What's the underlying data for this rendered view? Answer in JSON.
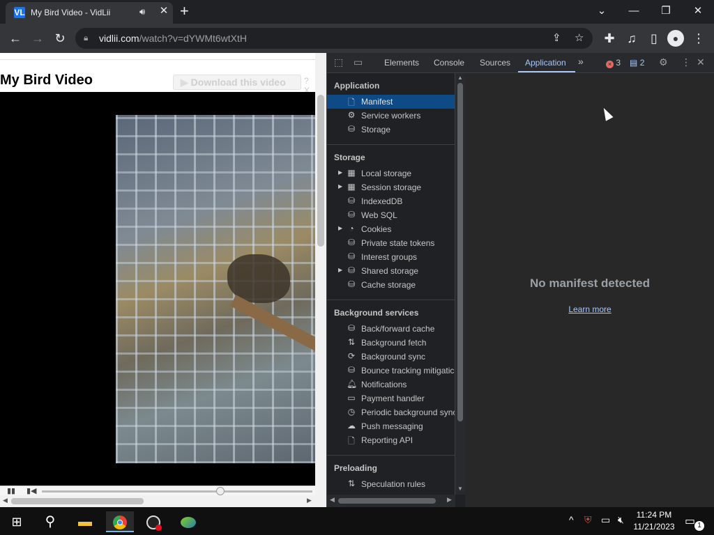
{
  "browser": {
    "tab": {
      "favicon": "VL",
      "title": "My Bird Video - VidLii",
      "audio_icon": "speaker-icon",
      "close": "✕"
    },
    "new_tab": "+",
    "window_controls": {
      "minimize": "—",
      "restore": "❐",
      "close": "✕",
      "tab_search": "⌄"
    },
    "url_host": "vidlii.com",
    "url_path": "/watch?v=dYWMt6wtXtH"
  },
  "page": {
    "title": "My Bird Video",
    "download_button": "Download this video",
    "help": "?",
    "close": "X"
  },
  "devtools": {
    "tabs": [
      "Elements",
      "Console",
      "Sources",
      "Application"
    ],
    "active_tab": "Application",
    "more_tabs": "»",
    "errors": "3",
    "messages": "2",
    "sections": {
      "application": {
        "header": "Application",
        "items": [
          {
            "label": "Manifest",
            "icon": "document-icon",
            "selected": true
          },
          {
            "label": "Service workers",
            "icon": "gears-icon"
          },
          {
            "label": "Storage",
            "icon": "database-icon"
          }
        ]
      },
      "storage": {
        "header": "Storage",
        "items": [
          {
            "label": "Local storage",
            "icon": "table-icon",
            "expandable": true
          },
          {
            "label": "Session storage",
            "icon": "table-icon",
            "expandable": true
          },
          {
            "label": "IndexedDB",
            "icon": "database-icon"
          },
          {
            "label": "Web SQL",
            "icon": "database-icon"
          },
          {
            "label": "Cookies",
            "icon": "cookie-icon",
            "expandable": true
          },
          {
            "label": "Private state tokens",
            "icon": "database-icon"
          },
          {
            "label": "Interest groups",
            "icon": "database-icon"
          },
          {
            "label": "Shared storage",
            "icon": "database-icon",
            "expandable": true
          },
          {
            "label": "Cache storage",
            "icon": "database-icon"
          }
        ]
      },
      "background": {
        "header": "Background services",
        "items": [
          {
            "label": "Back/forward cache",
            "icon": "database-icon"
          },
          {
            "label": "Background fetch",
            "icon": "arrows-updown-icon"
          },
          {
            "label": "Background sync",
            "icon": "sync-icon"
          },
          {
            "label": "Bounce tracking mitigatic",
            "icon": "database-icon"
          },
          {
            "label": "Notifications",
            "icon": "bell-icon"
          },
          {
            "label": "Payment handler",
            "icon": "card-icon"
          },
          {
            "label": "Periodic background sync",
            "icon": "clock-icon"
          },
          {
            "label": "Push messaging",
            "icon": "cloud-icon"
          },
          {
            "label": "Reporting API",
            "icon": "document-icon"
          }
        ]
      },
      "preloading": {
        "header": "Preloading",
        "items": [
          {
            "label": "Speculation rules",
            "icon": "arrows-updown-icon"
          }
        ]
      }
    },
    "main": {
      "message": "No manifest detected",
      "link": "Learn more"
    }
  },
  "taskbar": {
    "time": "11:24 PM",
    "date": "11/21/2023",
    "notifications": "1"
  }
}
